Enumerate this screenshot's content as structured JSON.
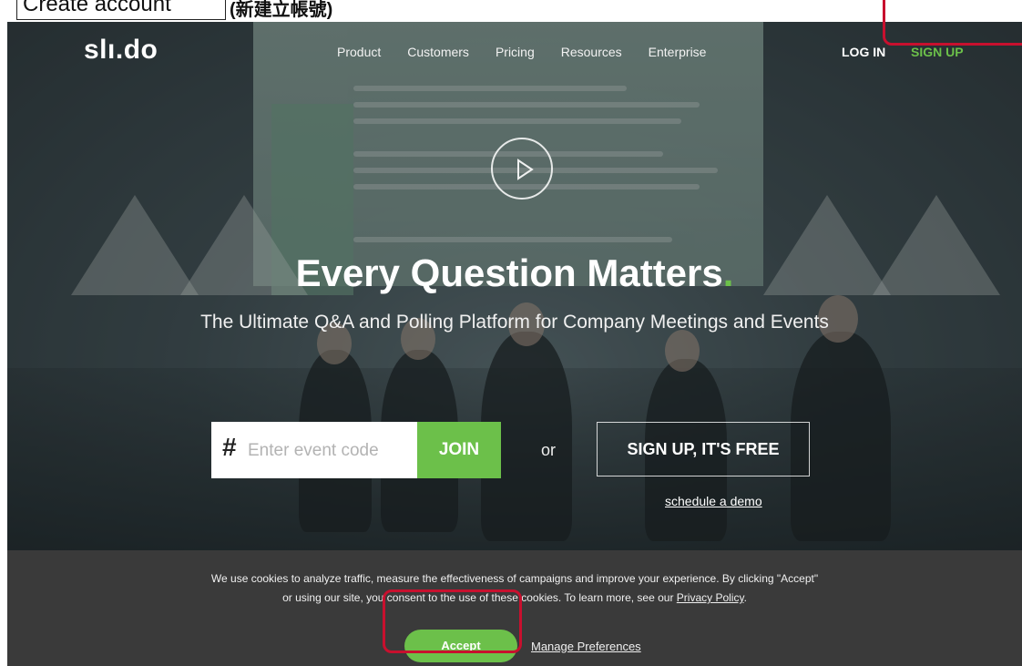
{
  "caption": {
    "title": "Create account",
    "subtitle": "(新建立帳號)"
  },
  "header": {
    "logo": "slı.do",
    "nav": [
      "Product",
      "Customers",
      "Pricing",
      "Resources",
      "Enterprise"
    ],
    "login": "LOG IN",
    "signup": "SIGN UP"
  },
  "hero": {
    "headline": "Every Question Matters",
    "headline_dot": ".",
    "subheadline": "The Ultimate Q&A and Polling Platform for Company Meetings and Events",
    "video_button": "play-icon"
  },
  "join_form": {
    "hash": "#",
    "placeholder": "Enter event code",
    "join_label": "JOIN",
    "or_label": "or",
    "signup_free": "SIGN UP, IT'S FREE",
    "demo_link": "schedule a demo"
  },
  "cookie_banner": {
    "line1": "We use cookies to analyze traffic, measure the effectiveness of campaigns and improve your experience. By clicking \"Accept\"",
    "line2_prefix": "or using our site, you consent to the use of these cookies. To learn more, see our ",
    "privacy_link": "Privacy Policy",
    "line2_suffix": ".",
    "accept_label": "Accept",
    "manage_label": "Manage Preferences"
  },
  "colors": {
    "accent_green": "#6cc04a",
    "highlight_red": "#c8102e",
    "banner_bg": "#3a3a3a"
  }
}
